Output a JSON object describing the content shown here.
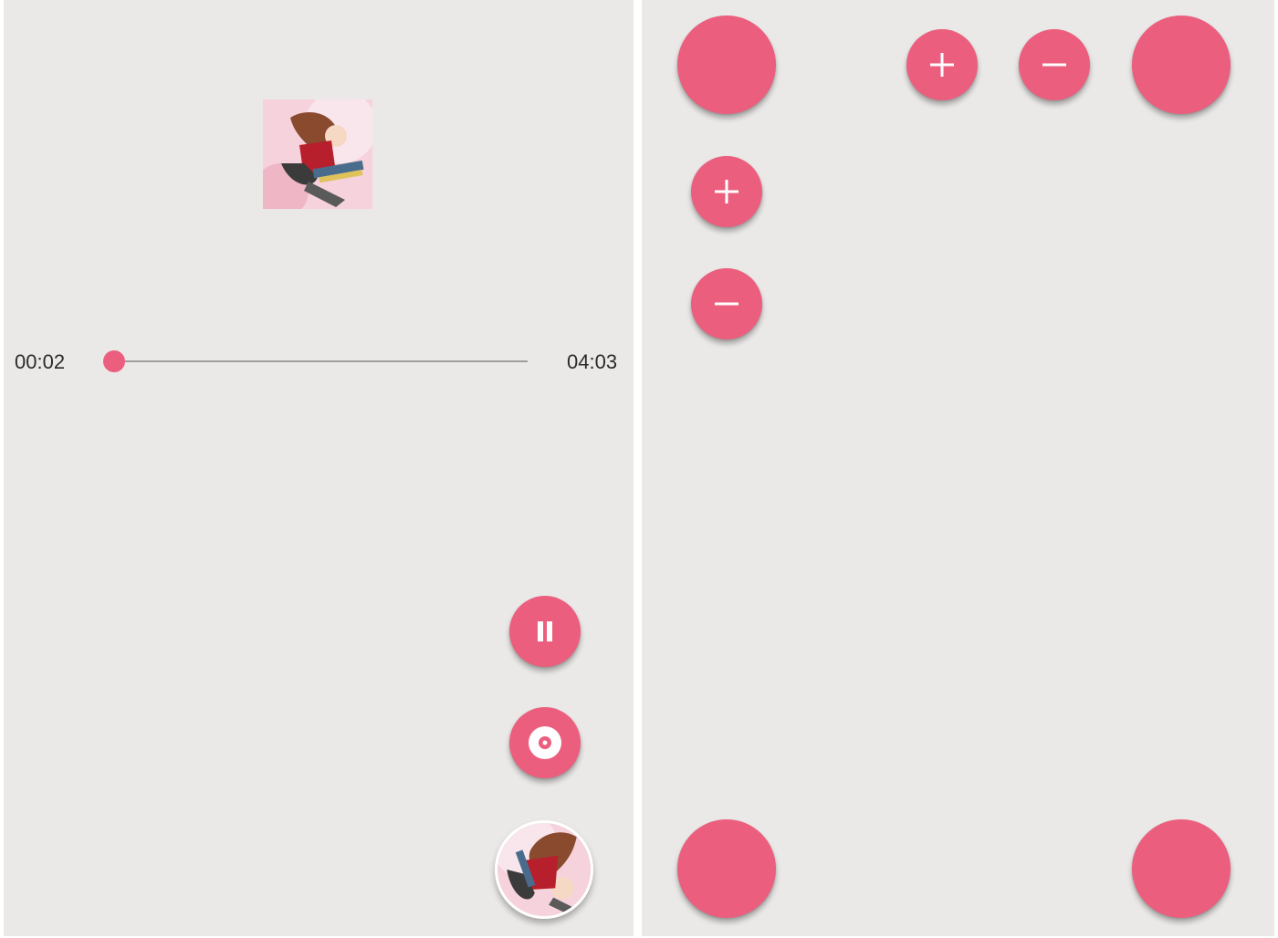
{
  "player": {
    "elapsed": "00:02",
    "total": "04:03",
    "progress_fraction": 0.01
  },
  "icons": {
    "play_pause": "pause-icon",
    "record": "disc-icon",
    "add": "plus-icon",
    "remove": "minus-icon"
  },
  "colors": {
    "accent": "#ec5e7e",
    "background": "#eae9e7"
  }
}
